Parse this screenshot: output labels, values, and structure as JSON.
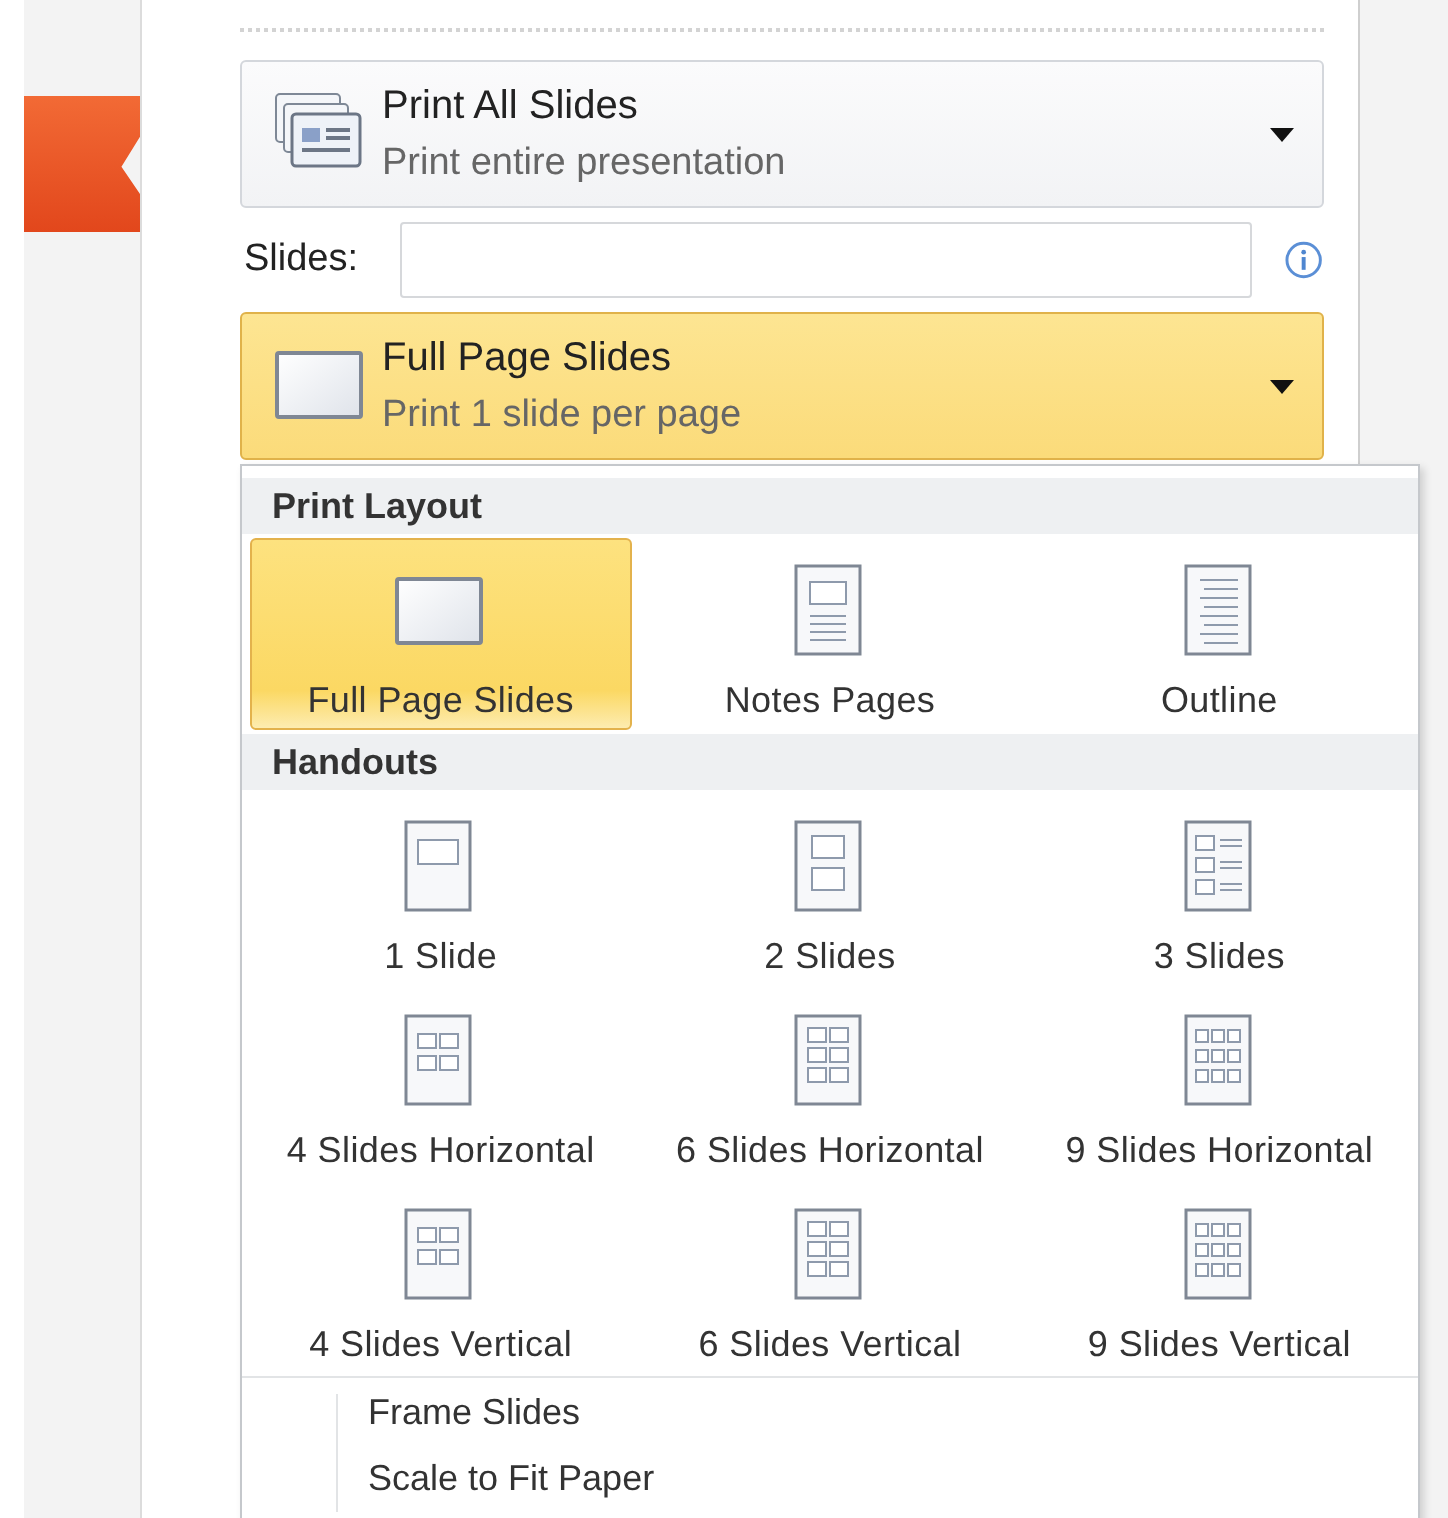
{
  "print_range": {
    "title": "Print All Slides",
    "subtitle": "Print entire presentation"
  },
  "slides_field": {
    "label": "Slides:"
  },
  "layout_button": {
    "title": "Full Page Slides",
    "subtitle": "Print 1 slide per page",
    "open": true
  },
  "menu": {
    "sections": [
      {
        "heading": "Print Layout",
        "items": [
          {
            "label": "Full Page Slides",
            "kind": "slide",
            "selected": true
          },
          {
            "label": "Notes Pages",
            "kind": "notes",
            "selected": false
          },
          {
            "label": "Outline",
            "kind": "outline",
            "selected": false
          }
        ]
      },
      {
        "heading": "Handouts",
        "items": [
          {
            "label": "1 Slide",
            "kind": "h1",
            "selected": false
          },
          {
            "label": "2 Slides",
            "kind": "h2",
            "selected": false
          },
          {
            "label": "3 Slides",
            "kind": "h3",
            "selected": false
          },
          {
            "label": "4 Slides Horizontal",
            "kind": "h4",
            "selected": false
          },
          {
            "label": "6 Slides Horizontal",
            "kind": "h6",
            "selected": false
          },
          {
            "label": "9 Slides Horizontal",
            "kind": "h9",
            "selected": false
          },
          {
            "label": "4 Slides Vertical",
            "kind": "h4",
            "selected": false
          },
          {
            "label": "6 Slides Vertical",
            "kind": "h6",
            "selected": false
          },
          {
            "label": "9 Slides Vertical",
            "kind": "h9",
            "selected": false
          }
        ]
      }
    ],
    "options": [
      {
        "label": "Frame Slides"
      },
      {
        "label": "Scale to Fit Paper"
      }
    ]
  }
}
